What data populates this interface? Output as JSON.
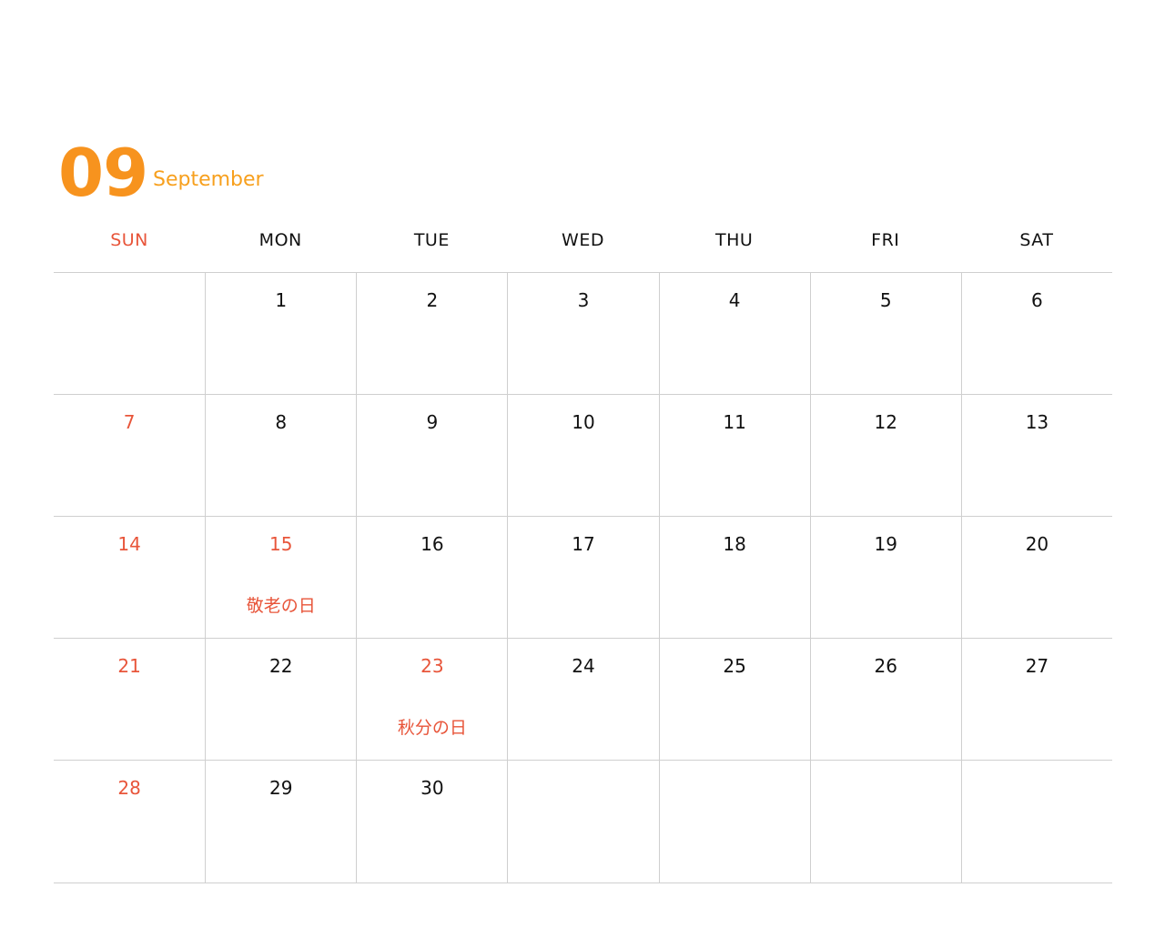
{
  "header": {
    "month_number": "09",
    "month_name": "September",
    "accent_color": "#f7931e"
  },
  "weekdays": [
    "SUN",
    "MON",
    "TUE",
    "WED",
    "THU",
    "FRI",
    "SAT"
  ],
  "colors": {
    "text": "#111111",
    "holiday_red": "#e8553a",
    "grid_line": "#cfcfcf"
  },
  "weeks": [
    [
      {
        "day": "",
        "holiday": ""
      },
      {
        "day": "1",
        "holiday": ""
      },
      {
        "day": "2",
        "holiday": ""
      },
      {
        "day": "3",
        "holiday": ""
      },
      {
        "day": "4",
        "holiday": ""
      },
      {
        "day": "5",
        "holiday": ""
      },
      {
        "day": "6",
        "holiday": ""
      }
    ],
    [
      {
        "day": "7",
        "holiday": ""
      },
      {
        "day": "8",
        "holiday": ""
      },
      {
        "day": "9",
        "holiday": ""
      },
      {
        "day": "10",
        "holiday": ""
      },
      {
        "day": "11",
        "holiday": ""
      },
      {
        "day": "12",
        "holiday": ""
      },
      {
        "day": "13",
        "holiday": ""
      }
    ],
    [
      {
        "day": "14",
        "holiday": ""
      },
      {
        "day": "15",
        "holiday": "敬老の日"
      },
      {
        "day": "16",
        "holiday": ""
      },
      {
        "day": "17",
        "holiday": ""
      },
      {
        "day": "18",
        "holiday": ""
      },
      {
        "day": "19",
        "holiday": ""
      },
      {
        "day": "20",
        "holiday": ""
      }
    ],
    [
      {
        "day": "21",
        "holiday": ""
      },
      {
        "day": "22",
        "holiday": ""
      },
      {
        "day": "23",
        "holiday": "秋分の日"
      },
      {
        "day": "24",
        "holiday": ""
      },
      {
        "day": "25",
        "holiday": ""
      },
      {
        "day": "26",
        "holiday": ""
      },
      {
        "day": "27",
        "holiday": ""
      }
    ],
    [
      {
        "day": "28",
        "holiday": ""
      },
      {
        "day": "29",
        "holiday": ""
      },
      {
        "day": "30",
        "holiday": ""
      },
      {
        "day": "",
        "holiday": ""
      },
      {
        "day": "",
        "holiday": ""
      },
      {
        "day": "",
        "holiday": ""
      },
      {
        "day": "",
        "holiday": ""
      }
    ]
  ]
}
